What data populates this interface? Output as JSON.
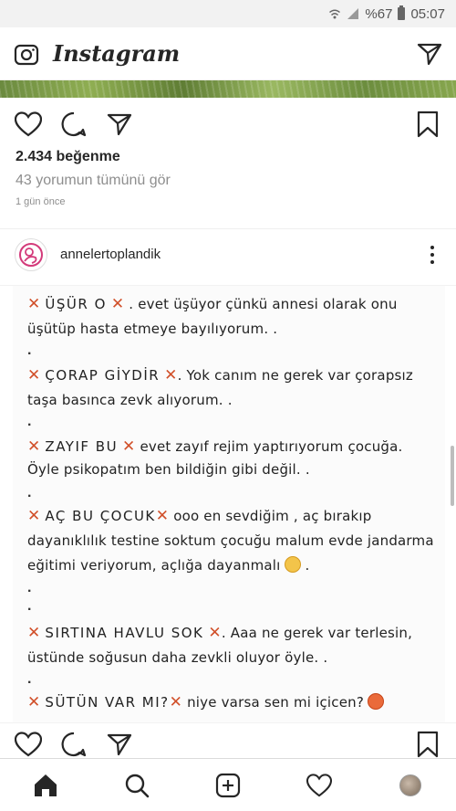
{
  "status_bar": {
    "battery": "%67",
    "time": "05:07"
  },
  "header": {
    "logo": "Instagram",
    "camera_icon": "camera-icon",
    "direct_icon": "paper-plane-icon"
  },
  "post": {
    "likes": "2.434 beğenme",
    "comments_link": "43 yorumun tümünü gör",
    "time_ago": "1 gün önce",
    "author": "annelertoplandik"
  },
  "image_text": {
    "l1a": "ÜŞÜR O",
    "l1b": ". evet üşüyor çünkü annesi olarak onu",
    "l2": "üşütüp hasta etmeye bayılıyorum. .",
    "l3a": "ÇORAP GİYDİR",
    "l3b": ". Yok canım ne gerek var çorapsız",
    "l4": "taşa basınca zevk alıyorum. .",
    "l5a": "ZAYIF BU",
    "l5b": "evet zayıf rejim yaptırıyorum çocuğa.",
    "l6": "Öyle psikopatım ben bildiğin gibi değil. .",
    "l7a": "AÇ BU ÇOCUK",
    "l7b": "ooo en sevdiğim , aç bırakıp",
    "l8": "dayanıklılık testine soktum çocuğu malum evde jandarma",
    "l9": "eğitimi veriyorum, açlığa dayanmalı",
    "l10a": "SIRTINA HAVLU SOK",
    "l10b": ". Aaa ne gerek var terlesin,",
    "l11": "üstünde soğusun daha zevkli oluyor öyle. .",
    "l12a": "SÜTÜN VAR MI?",
    "l12b": "niye varsa sen mi içicen?",
    "x_mark": "✕",
    "dot": "."
  },
  "bottom_nav": [
    "home-icon",
    "search-icon",
    "add-post-icon",
    "heart-icon",
    "profile-avatar"
  ]
}
